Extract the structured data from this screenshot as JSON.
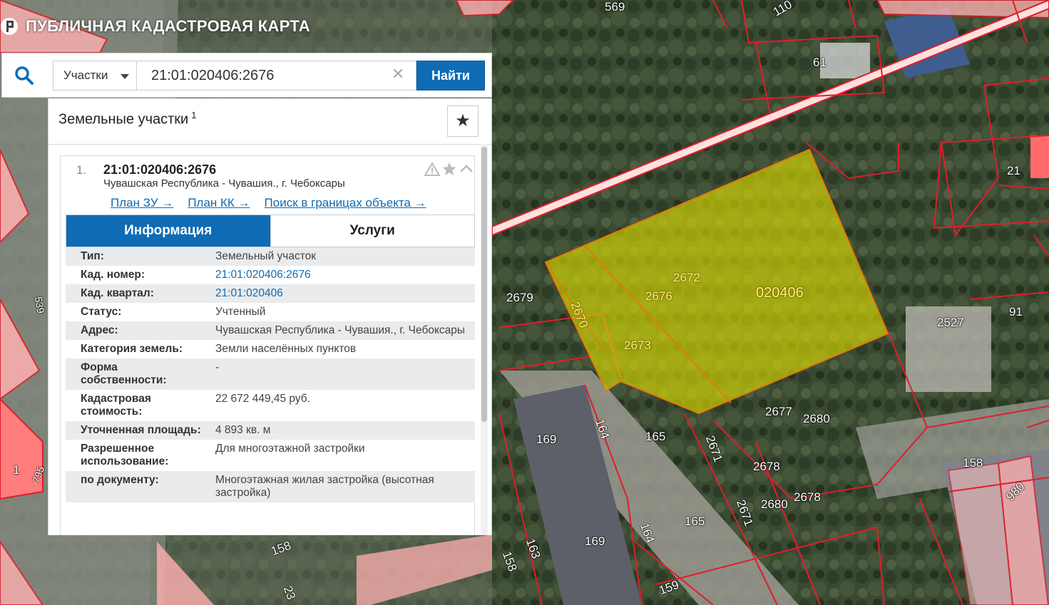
{
  "brand": {
    "title": "ПУБЛИЧНАЯ КАДАСТРОВАЯ КАРТА"
  },
  "search": {
    "scope": "Участки",
    "query": "21:01:020406:2676",
    "find_label": "Найти",
    "clear_glyph": "✕"
  },
  "panel": {
    "title": "Земельные участки",
    "count": "1",
    "fav_glyph": "★"
  },
  "card": {
    "index": "1.",
    "cad_number": "21:01:020406:2676",
    "address": "Чувашская Республика - Чувашия., г. Чебоксары",
    "links": [
      "План ЗУ →",
      "План КК →",
      "Поиск в границах объекта →"
    ],
    "tabs": [
      {
        "label": "Информация",
        "active": true
      },
      {
        "label": "Услуги",
        "active": false
      }
    ],
    "rows": [
      {
        "label": "Тип:",
        "value": "Земельный участок"
      },
      {
        "label": "Кад. номер:",
        "value": "21:01:020406:2676"
      },
      {
        "label": "Кад. квартал:",
        "value": "21:01:020406"
      },
      {
        "label": "Статус:",
        "value": "Учтенный"
      },
      {
        "label": "Адрес:",
        "value": "Чувашская Республика - Чувашия., г. Чебоксары"
      },
      {
        "label": "Категория земель:",
        "value": "Земли населённых пунктов"
      },
      {
        "label": "Форма собственности:",
        "value": "-"
      },
      {
        "label": "Кадастровая стоимость:",
        "value": "22 672 449,45 руб."
      },
      {
        "label": "Уточненная площадь:",
        "value": "4 893 кв. м"
      },
      {
        "label": "Разрешенное использование:",
        "value": "Для многоэтажной застройки"
      },
      {
        "label": "по документу:",
        "value": "Многоэтажная жилая застройка (высотная застройка)"
      }
    ]
  },
  "map": {
    "parcel_labels": [
      "569",
      "110",
      "61",
      "21",
      "91",
      "2527",
      "2679",
      "2670",
      "2672",
      "2676",
      "2673",
      "020406",
      "2677",
      "2680",
      "165",
      "164",
      "169",
      "2671",
      "2678",
      "2680",
      "2678",
      "2671",
      "165",
      "164",
      "169",
      "163",
      "158",
      "158",
      "980",
      "159",
      "1",
      "795",
      "539",
      "158",
      "23"
    ],
    "highlight_color": "#e1e000",
    "boundary_color": "#e01e2a"
  }
}
